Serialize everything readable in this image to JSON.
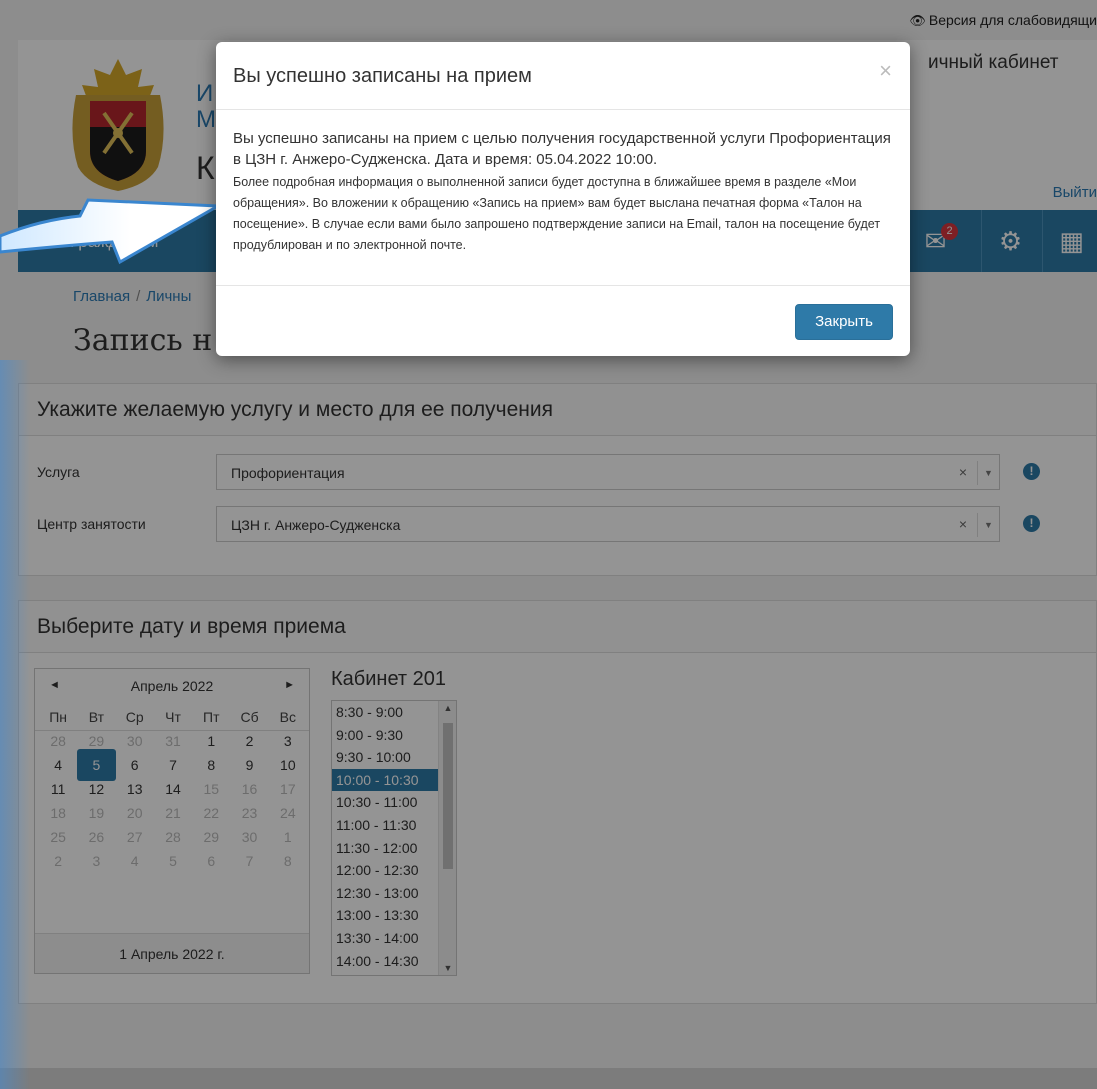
{
  "top": {
    "vision_link": "Версия для слабовидящи"
  },
  "header": {
    "brand_line1": "И",
    "brand_line2": "М",
    "brand_line3": "К",
    "cabinet_title": "ичный кабинет",
    "logout": "Выйти"
  },
  "navbar": {
    "citizens_label": "Гражданам",
    "messages_badge": "2",
    "icons": [
      "envelope-icon",
      "gear-icon",
      "calendar-icon"
    ]
  },
  "breadcrumb": {
    "home": "Главная",
    "separator": "/",
    "personal": "Личны"
  },
  "page_title": "Запись н",
  "service_panel": {
    "heading": "Укажите желаемую услугу и место для ее получения",
    "service_label": "Услуга",
    "service_value": "Профориентация",
    "center_label": "Центр занятости",
    "center_value": "ЦЗН г. Анжеро-Судженска",
    "clear_symbol": "×",
    "info_symbol": "!"
  },
  "date_panel": {
    "heading": "Выберите дату и время приема",
    "calendar": {
      "prev": "◄",
      "next": "►",
      "month": "Апрель 2022",
      "weekdays": [
        "Пн",
        "Вт",
        "Ср",
        "Чт",
        "Пт",
        "Сб",
        "Вс"
      ],
      "weeks": [
        [
          "28",
          "29",
          "30",
          "31",
          "1",
          "2",
          "3"
        ],
        [
          "4",
          "5",
          "6",
          "7",
          "8",
          "9",
          "10"
        ],
        [
          "11",
          "12",
          "13",
          "14",
          "15",
          "16",
          "17"
        ],
        [
          "18",
          "19",
          "20",
          "21",
          "22",
          "23",
          "24"
        ],
        [
          "25",
          "26",
          "27",
          "28",
          "29",
          "30",
          "1"
        ],
        [
          "2",
          "3",
          "4",
          "5",
          "6",
          "7",
          "8"
        ]
      ],
      "selected_day": "5",
      "footer": "1 Апрель 2022 г."
    },
    "room_title": "Кабинет 201",
    "slots": [
      "8:30 - 9:00",
      "9:00 - 9:30",
      "9:30 - 10:00",
      "10:00 - 10:30",
      "10:30 - 11:00",
      "11:00 - 11:30",
      "11:30 - 12:00",
      "12:00 - 12:30",
      "12:30 - 13:00",
      "13:00 - 13:30",
      "13:30 - 14:00",
      "14:00 - 14:30"
    ],
    "selected_slot": "10:00 - 10:30"
  },
  "modal": {
    "title": "Вы успешно записаны на прием",
    "close_symbol": "×",
    "lead": "Вы успешно записаны на прием с целью получения государственной услуги Профориентация в ЦЗН г. Анжеро-Судженска. Дата и время: 05.04.2022 10:00.",
    "details": "Более подробная информация о выполненной записи будет доступна в ближайшее время в разделе «Мои обращения». Во вложении к обращению «Запись на прием» вам будет выслана печатная форма «Талон на посещение». В случае если вами было запрошено подтверждение записи на Email, талон на посещение будет продублирован и по электронной почте.",
    "close_button": "Закрыть"
  },
  "colors": {
    "primary": "#2e7aa8",
    "badge": "#d9363e",
    "link": "#2b7bb5"
  }
}
